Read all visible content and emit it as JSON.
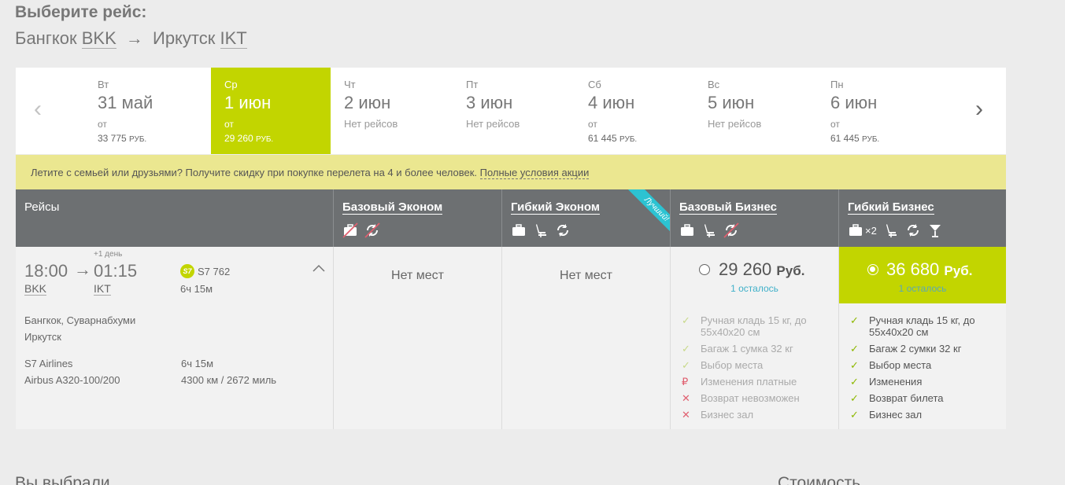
{
  "header": {
    "title": "Выберите рейс:",
    "origin_city": "Бангкок",
    "origin_code": "BKK",
    "arrow": "→",
    "dest_city": "Иркутск",
    "dest_code": "IKT"
  },
  "date_nav": {
    "prev": "‹",
    "next": "›",
    "days": [
      {
        "dow": "Вт",
        "date": "31 май",
        "from": "от",
        "price": "33 775",
        "currency": "РУБ.",
        "no_flights": ""
      },
      {
        "dow": "Ср",
        "date": "1 июн",
        "from": "от",
        "price": "29 260",
        "currency": "РУБ.",
        "no_flights": "",
        "selected": true
      },
      {
        "dow": "Чт",
        "date": "2 июн",
        "from": "",
        "price": "",
        "currency": "",
        "no_flights": "Нет рейсов"
      },
      {
        "dow": "Пт",
        "date": "3 июн",
        "from": "",
        "price": "",
        "currency": "",
        "no_flights": "Нет рейсов"
      },
      {
        "dow": "Сб",
        "date": "4 июн",
        "from": "от",
        "price": "61 445",
        "currency": "РУБ.",
        "no_flights": ""
      },
      {
        "dow": "Вс",
        "date": "5 июн",
        "from": "",
        "price": "",
        "currency": "",
        "no_flights": "Нет рейсов"
      },
      {
        "dow": "Пн",
        "date": "6 июн",
        "from": "от",
        "price": "61 445",
        "currency": "РУБ.",
        "no_flights": ""
      }
    ]
  },
  "promo": {
    "text": "Летите с семьей или друзьями? Получите скидку при покупке перелета на 4 и более человек.",
    "link": "Полные условия акции"
  },
  "table_header": {
    "flights": "Рейсы",
    "fares": [
      {
        "name": "Базовый Эконом",
        "icons": [
          "baggage-crossed-icon",
          "change-crossed-icon"
        ]
      },
      {
        "name": "Гибкий Эконом",
        "icons": [
          "baggage-icon",
          "seat-icon",
          "change-icon"
        ],
        "ribbon": "Лучший!"
      },
      {
        "name": "Базовый Бизнес",
        "icons": [
          "baggage-icon",
          "seat-icon",
          "change-crossed-icon"
        ]
      },
      {
        "name": "Гибкий Бизнес",
        "icons": [
          "baggage-icon",
          "seat-icon",
          "change-icon",
          "cocktail-icon"
        ],
        "baggage_count": "×2"
      }
    ]
  },
  "flight": {
    "dep_time": "18:00",
    "arr_time": "01:15",
    "plus_day": "+1 день",
    "dep_code": "BKK",
    "arr_code": "IKT",
    "airline_logo": "S7",
    "flight_no": "S7 762",
    "duration": "6ч 15м",
    "dep_airport": "Бангкок, Суварнабхуми",
    "arr_airport": "Иркутск",
    "airline": "S7 Airlines",
    "aircraft": "Airbus A320-100/200",
    "duration2": "6ч 15м",
    "distance": "4300 км / 2672 миль",
    "collapse": "⌃"
  },
  "fares": {
    "base_economy": {
      "status": "Нет мест"
    },
    "flex_economy": {
      "status": "Нет мест"
    },
    "base_business": {
      "amount": "29 260",
      "currency": "Руб.",
      "left": "1 осталось",
      "features": [
        {
          "mark": "✓",
          "type": "yes",
          "text": "Ручная кладь 15 кг, до 55х40х20 см"
        },
        {
          "mark": "✓",
          "type": "yes",
          "text": "Багаж 1 сумка 32 кг"
        },
        {
          "mark": "✓",
          "type": "yes",
          "text": "Выбор места"
        },
        {
          "mark": "₽",
          "type": "paid",
          "text": "Изменения платные"
        },
        {
          "mark": "✕",
          "type": "no",
          "text": "Возврат невозможен"
        },
        {
          "mark": "✕",
          "type": "no",
          "text": "Бизнес зал"
        }
      ]
    },
    "flex_business": {
      "amount": "36 680",
      "currency": "Руб.",
      "left": "1 осталось",
      "features": [
        {
          "mark": "✓",
          "type": "yes",
          "text": "Ручная кладь 15 кг, до 55х40х20 см"
        },
        {
          "mark": "✓",
          "type": "yes",
          "text": "Багаж 2 сумки 32 кг"
        },
        {
          "mark": "✓",
          "type": "yes",
          "text": "Выбор места"
        },
        {
          "mark": "✓",
          "type": "yes",
          "text": "Изменения"
        },
        {
          "mark": "✓",
          "type": "yes",
          "text": "Возврат билета"
        },
        {
          "mark": "✓",
          "type": "yes",
          "text": "Бизнес зал"
        }
      ]
    }
  },
  "footer": {
    "selected": "Вы выбрали",
    "cost": "Стоимость"
  }
}
